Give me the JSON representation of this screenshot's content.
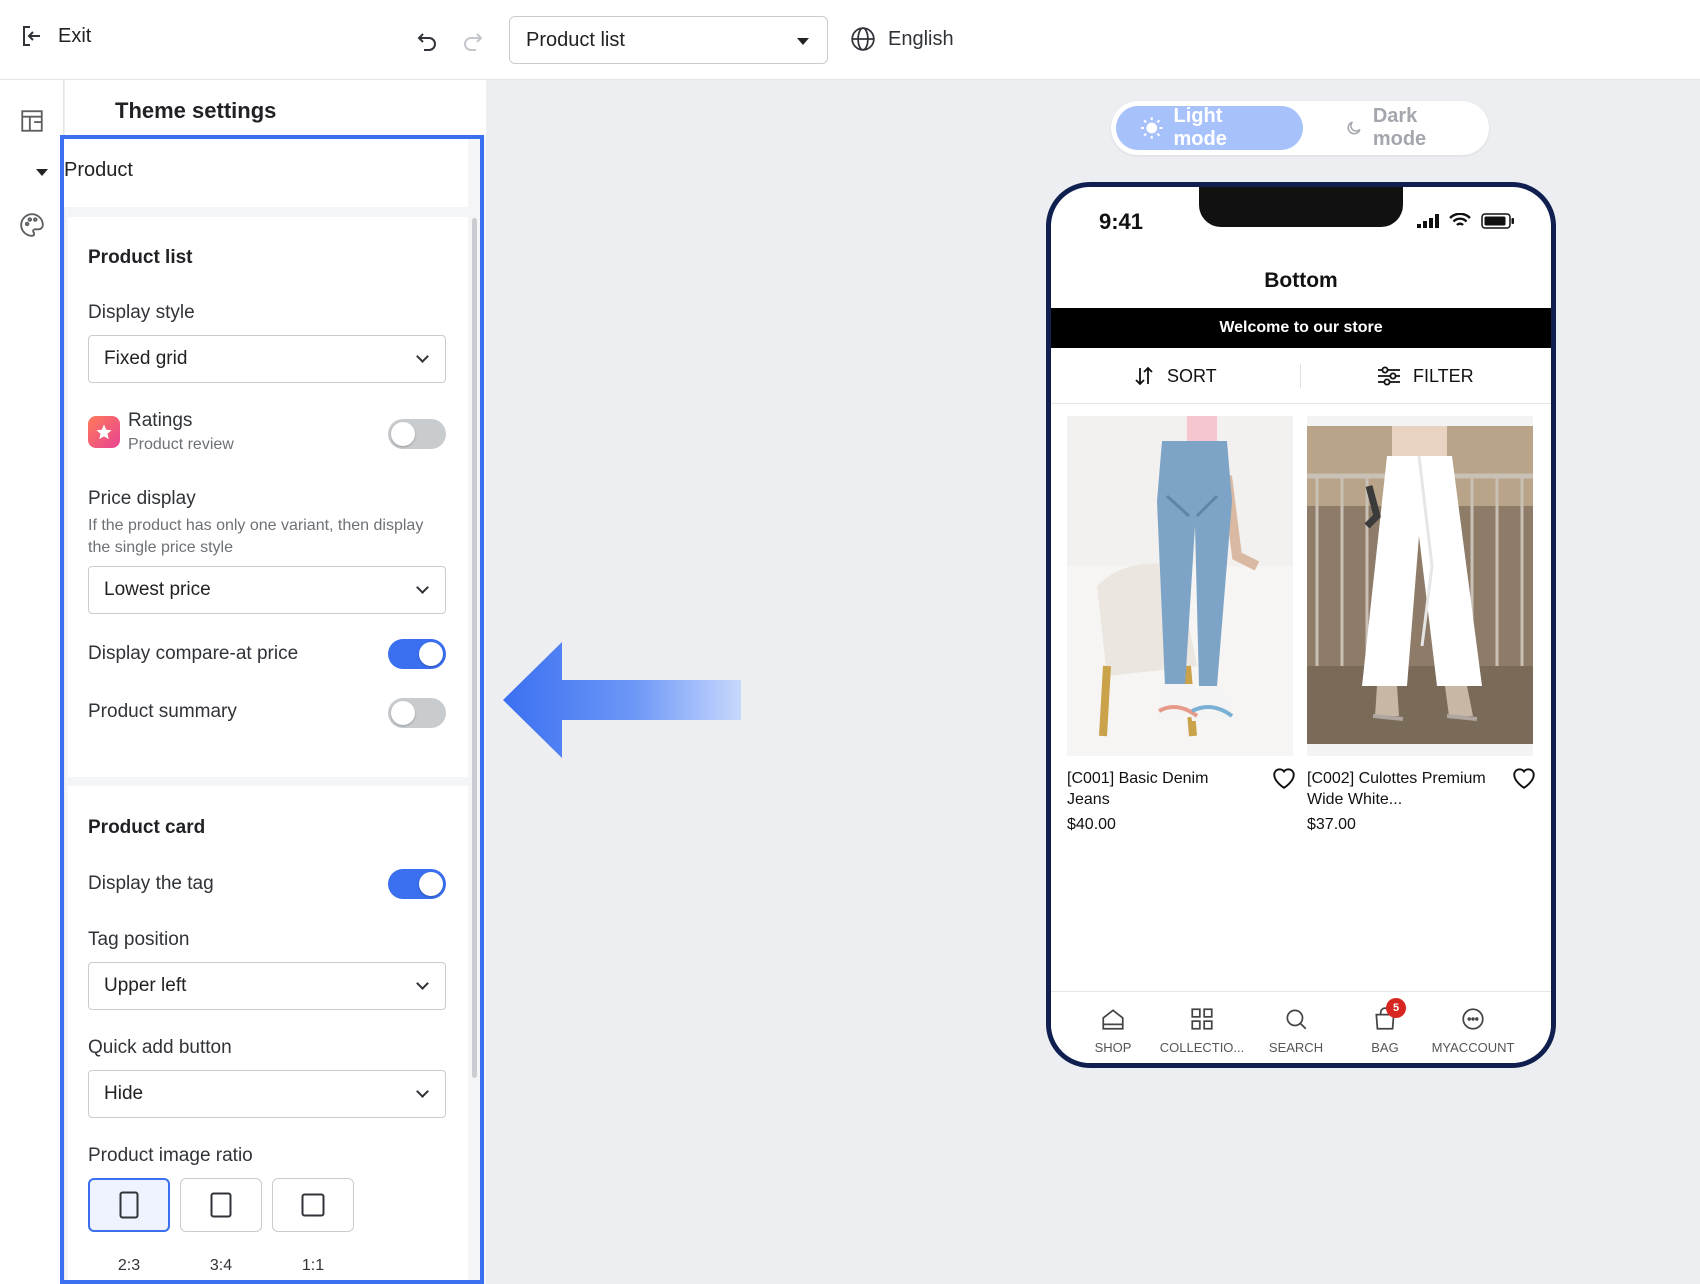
{
  "topbar": {
    "exit_label": "Exit",
    "page_select_value": "Product list",
    "language": "English"
  },
  "panel": {
    "title": "Theme settings",
    "section_label": "Product",
    "product_list": {
      "heading": "Product list",
      "display_style_label": "Display style",
      "display_style_value": "Fixed grid",
      "ratings_title": "Ratings",
      "ratings_subtitle": "Product review",
      "ratings_on": false,
      "price_display_label": "Price display",
      "price_display_help": "If the product has only one variant, then display the single price style",
      "price_display_value": "Lowest price",
      "compare_at_label": "Display compare-at price",
      "compare_at_on": true,
      "summary_label": "Product summary",
      "summary_on": false
    },
    "product_card": {
      "heading": "Product card",
      "display_tag_label": "Display the tag",
      "display_tag_on": true,
      "tag_position_label": "Tag position",
      "tag_position_value": "Upper left",
      "quick_add_label": "Quick add button",
      "quick_add_value": "Hide",
      "image_ratio_label": "Product image ratio",
      "ratios": [
        "2:3",
        "3:4",
        "1:1"
      ],
      "selected_ratio": "2:3"
    }
  },
  "preview": {
    "light_mode": "Light mode",
    "dark_mode": "Dark mode",
    "time": "9:41",
    "page_title": "Bottom",
    "banner": "Welcome to our store",
    "sort": "SORT",
    "filter": "FILTER",
    "products": [
      {
        "name": "[C001] Basic Denim Jeans",
        "price": "$40.00"
      },
      {
        "name": "[C002] Culottes Premium Wide White...",
        "price": "$37.00"
      }
    ],
    "tabs": [
      "SHOP",
      "COLLECTIO...",
      "SEARCH",
      "BAG",
      "MYACCOUNT"
    ],
    "bag_count": "5"
  },
  "colors": {
    "accent": "#3a6ff0",
    "phone_frame": "#0f1f4f",
    "badge": "#d6261f"
  }
}
